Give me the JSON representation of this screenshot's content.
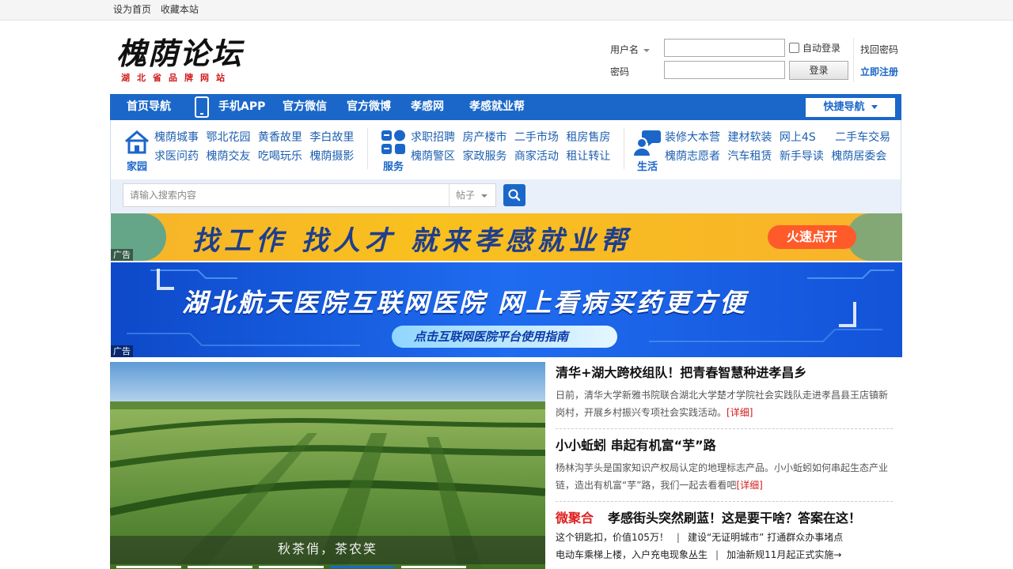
{
  "topbar": {
    "set_home": "设为首页",
    "bookmark": "收藏本站"
  },
  "logo": {
    "brand": "槐荫论坛",
    "tagline": "湖北省品牌网站"
  },
  "login": {
    "username_label": "用户名",
    "password_label": "密码",
    "username_value": "",
    "password_value": "",
    "auto_login": "自动登录",
    "submit": "登录",
    "forgot": "找回密码",
    "register": "立即注册"
  },
  "nav": {
    "items": [
      {
        "label": "首页导航"
      },
      {
        "label": "手机APP"
      },
      {
        "label": "官方微信"
      },
      {
        "label": "官方微博"
      },
      {
        "label": "孝感网"
      },
      {
        "label": "孝感就业帮"
      }
    ],
    "quick": "快捷导航"
  },
  "categories": [
    {
      "name": "家园",
      "icon": "home-icon",
      "rows": [
        [
          "槐荫城事",
          "鄂北花园",
          "黄香故里",
          "李白故里"
        ],
        [
          "求医问药",
          "槐荫交友",
          "吃喝玩乐",
          "槐荫摄影"
        ]
      ]
    },
    {
      "name": "服务",
      "icon": "grid-apps-icon",
      "rows": [
        [
          "求职招聘",
          "房产楼市",
          "二手市场",
          "租房售房"
        ],
        [
          "槐荫警区",
          "家政服务",
          "商家活动",
          "租让转让"
        ]
      ]
    },
    {
      "name": "生活",
      "icon": "people-chat-icon",
      "rows": [
        [
          "装修大本营",
          "建材软装",
          "网上4S",
          "二手车交易"
        ],
        [
          "槐荫志愿者",
          "汽车租赁",
          "新手导读",
          "槐荫居委会"
        ]
      ]
    }
  ],
  "search": {
    "placeholder": "请输入搜索内容",
    "scope": "帖子"
  },
  "ads": {
    "label": "广告",
    "ad1_text": "找工作 找人才 就来孝感就业帮",
    "ad1_cta": "火速点开",
    "ad2_text": "湖北航天医院互联网医院 网上看病买药更方便",
    "ad2_sub": "点击互联网医院平台使用指南"
  },
  "slideshow": {
    "caption": "秋茶俏，茶农笑"
  },
  "news": {
    "items": [
      {
        "title": "清华+湖大跨校组队！把青春智慧种进孝昌乡",
        "summary": "日前，清华大学新雅书院联合湖北大学楚才学院社会实践队走进孝昌县王店镇新岗村，开展乡村振兴专项社会实践活动。",
        "more": "[详细]"
      },
      {
        "title": "小小蚯蚓 串起有机富“芋”路",
        "summary": "杨林沟芋头是国家知识产权局认定的地理标志产品。小小蚯蚓如何串起生态产业链，造出有机富“芋”路，我们一起去看看吧",
        "more": "[详细]"
      }
    ],
    "weijuhe_label": "微聚合",
    "weijuhe_title": "孝感街头突然刷蓝！这是要干啥？答案在这！",
    "lines": [
      {
        "a": "这个钥匙扣，价值105万！",
        "b": "建设“无证明城市” 打通群众办事堵点"
      },
      {
        "a": "电动车乘梯上楼，入户充电现象丛生",
        "b": "加油新规11月起正式实施→"
      }
    ]
  },
  "colors": {
    "brand_blue": "#1b67c9",
    "link_blue": "#1d5fb0",
    "accent_red": "#e02020"
  }
}
